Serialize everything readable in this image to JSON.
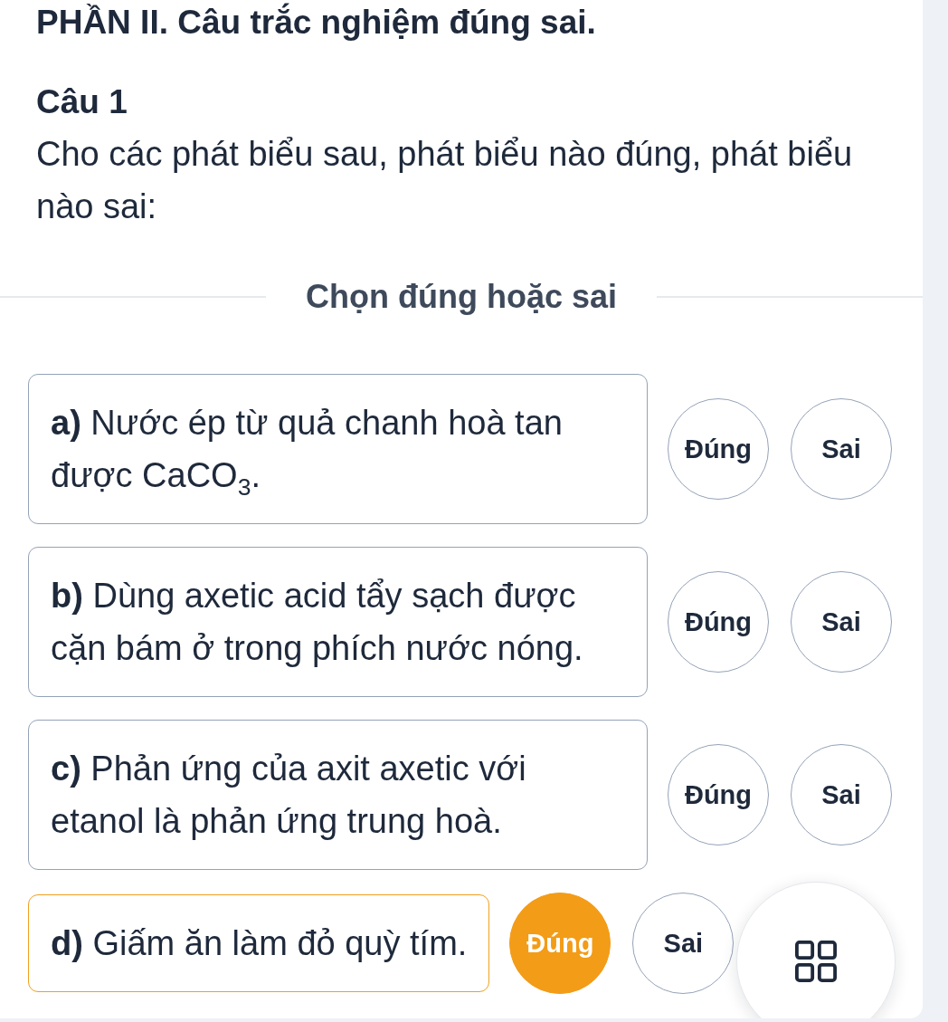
{
  "section_title": "PHẦN II. Câu trắc nghiệm đúng sai.",
  "question": {
    "label": "Câu 1",
    "text": "Cho các phát biểu sau, phát biểu nào đúng, phát biểu nào sai:"
  },
  "divider_label": "Chọn đúng hoặc sai",
  "statements": [
    {
      "text": "**a)** Nước ép từ quả chanh hoà tan được CaCO$_{3}$.",
      "options": [
        {
          "label": "Đúng",
          "selected": false
        },
        {
          "label": "Sai",
          "selected": false
        }
      ]
    },
    {
      "text": "**b)** Dùng axetic acid tẩy sạch được cặn bám ở trong phích nước nóng.",
      "options": [
        {
          "label": "Đúng",
          "selected": false
        },
        {
          "label": "Sai",
          "selected": false
        }
      ]
    },
    {
      "text": "**c)** Phản ứng của axit axetic với etanol là phản ứng trung hoà.",
      "options": [
        {
          "label": "Đúng",
          "selected": false
        },
        {
          "label": "Sai",
          "selected": false
        }
      ]
    },
    {
      "text": "**d)** Giấm ăn làm đỏ quỳ tím.",
      "options": [
        {
          "label": "Đúng",
          "selected": true
        },
        {
          "label": "Sai",
          "selected": false
        }
      ]
    }
  ]
}
